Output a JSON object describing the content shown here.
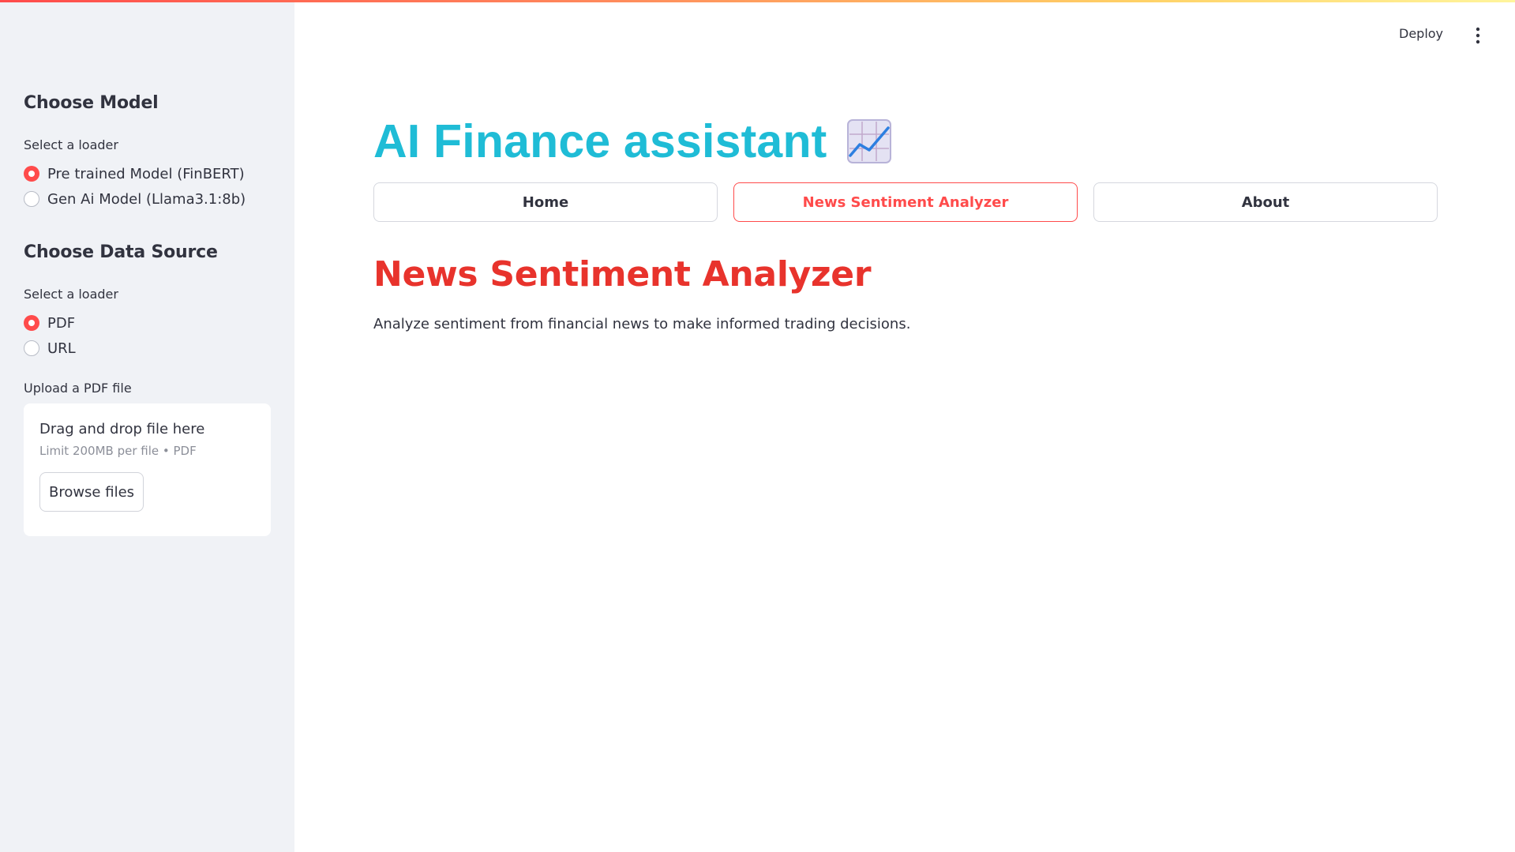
{
  "sidebar": {
    "model_heading": "Choose Model",
    "model_loader_label": "Select a loader",
    "model_options": [
      {
        "label": "Pre trained Model (FinBERT)",
        "selected": true
      },
      {
        "label": "Gen Ai Model (Llama3.1:8b)",
        "selected": false
      }
    ],
    "source_heading": "Choose Data Source",
    "source_loader_label": "Select a loader",
    "source_options": [
      {
        "label": "PDF",
        "selected": true
      },
      {
        "label": "URL",
        "selected": false
      }
    ],
    "upload_label": "Upload a PDF file",
    "uploader": {
      "title": "Drag and drop file here",
      "limit": "Limit 200MB per file • PDF",
      "browse_label": "Browse files"
    }
  },
  "header": {
    "deploy_label": "Deploy",
    "menu_icon": "kebab-menu-icon"
  },
  "main": {
    "title": "AI Finance assistant",
    "title_icon": "chart-increasing-icon",
    "tabs": [
      {
        "label": "Home",
        "active": false
      },
      {
        "label": "News Sentiment Analyzer",
        "active": true
      },
      {
        "label": "About",
        "active": false
      }
    ],
    "section_heading": "News Sentiment Analyzer",
    "section_description": "Analyze sentiment from financial news to make informed trading decisions."
  },
  "colors": {
    "accent": "#ff4b4b",
    "title": "#1fbcd6",
    "heading": "#e8332c",
    "sidebar_bg": "#f0f2f6"
  }
}
